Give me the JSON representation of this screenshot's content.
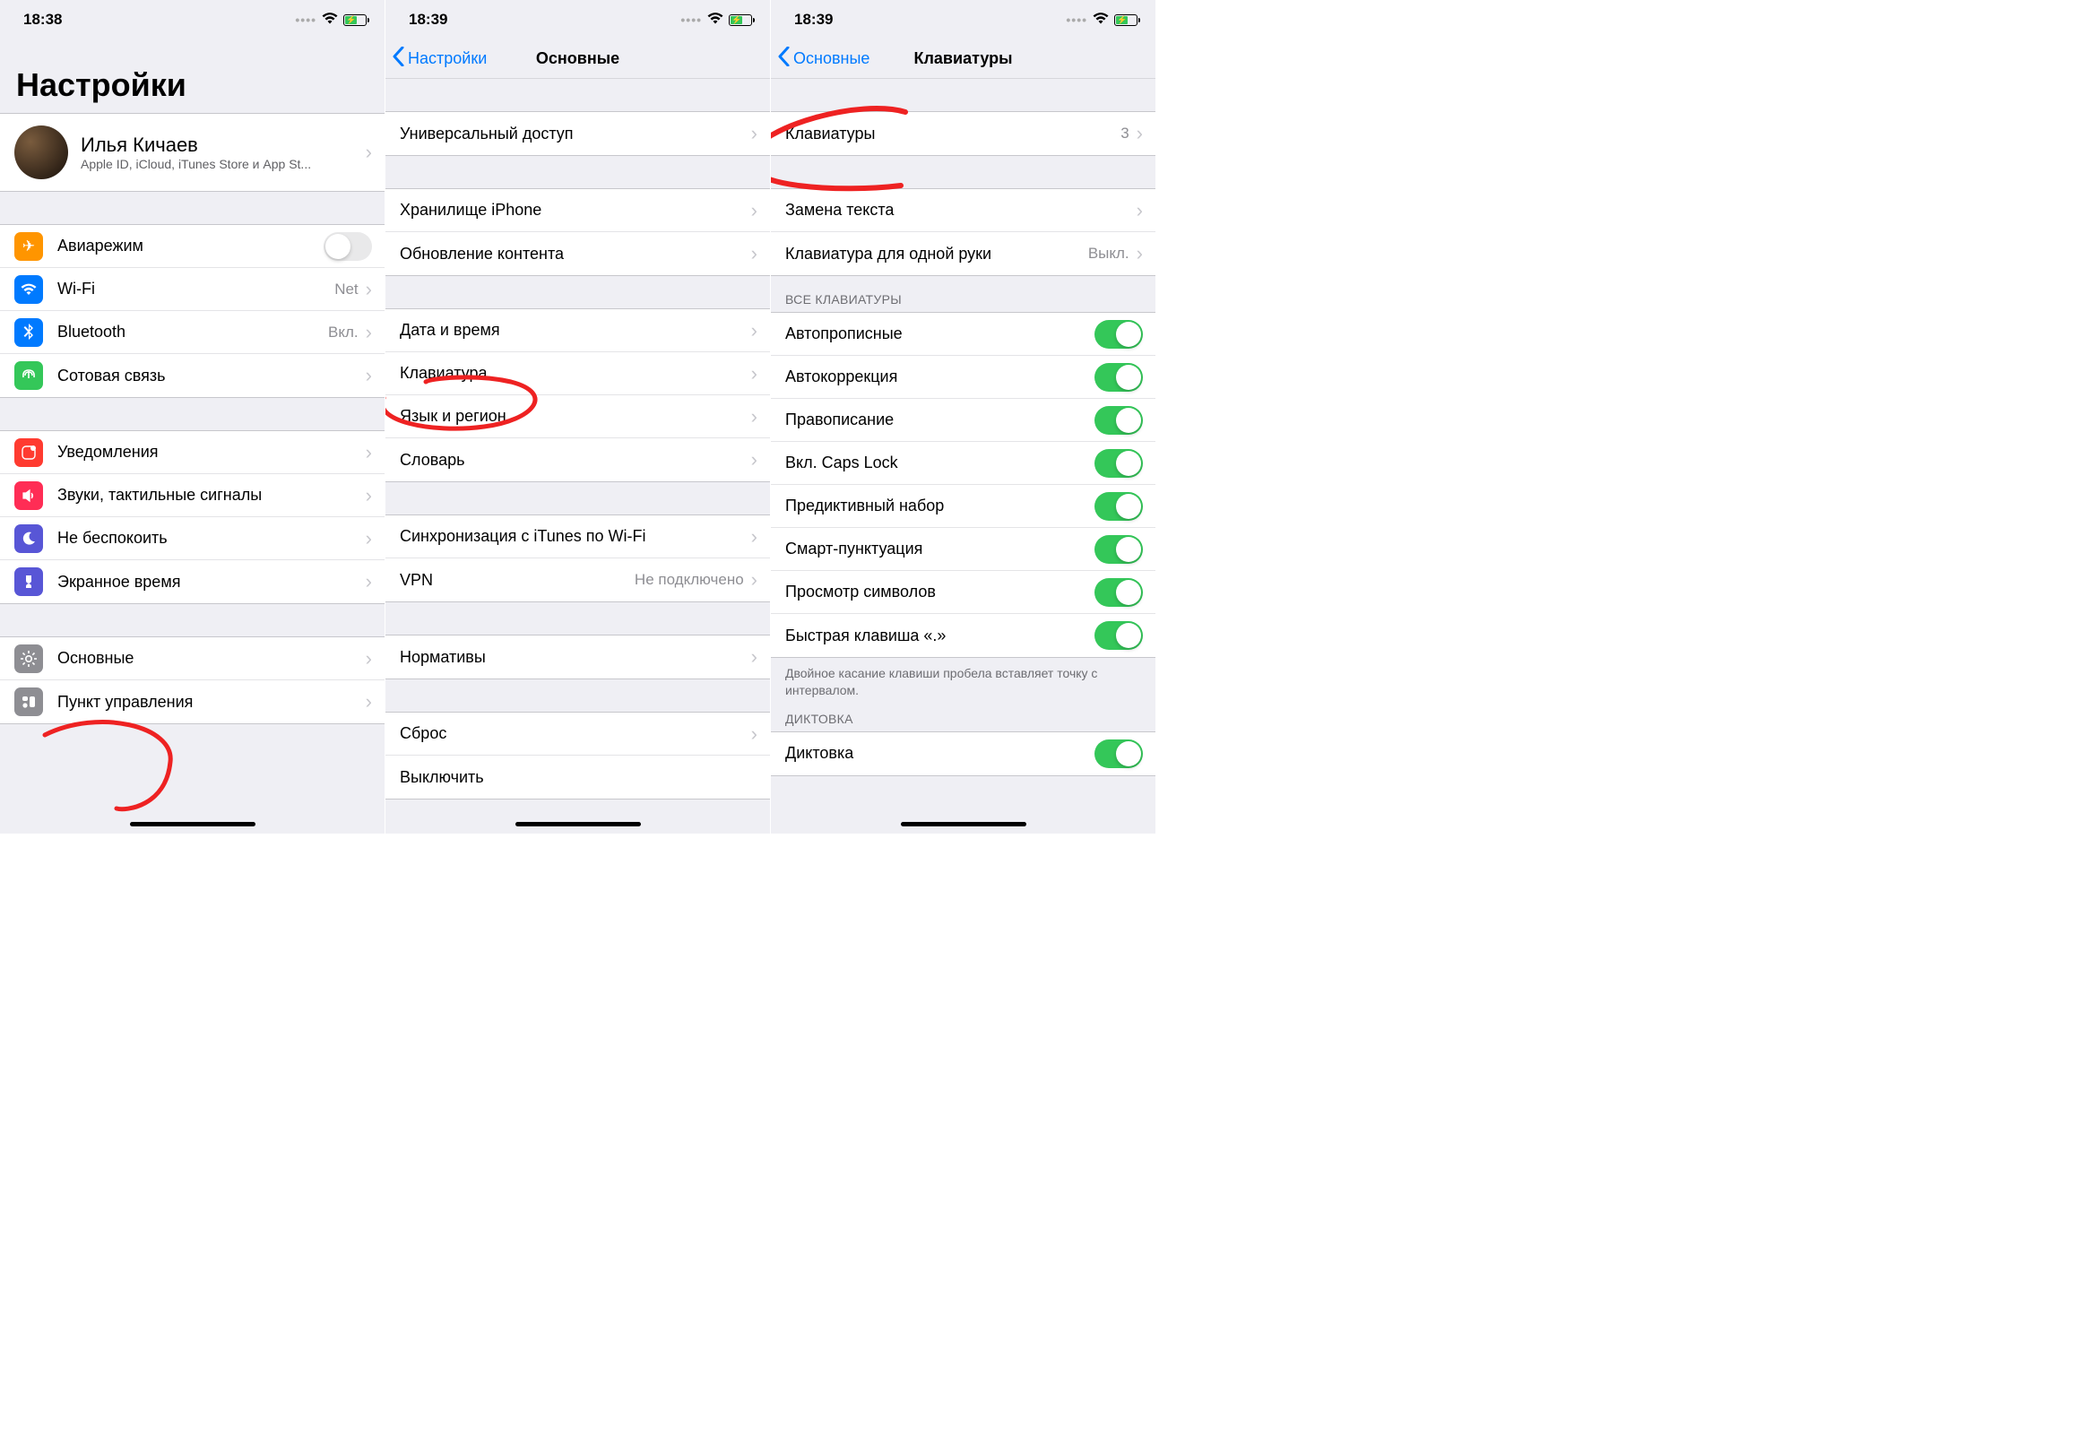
{
  "screens": {
    "settings": {
      "time": "18:38",
      "title": "Настройки",
      "profile": {
        "name": "Илья Кичаев",
        "sub": "Apple ID, iCloud, iTunes Store и App St..."
      },
      "rows": {
        "airplane": "Авиарежим",
        "wifi": "Wi-Fi",
        "wifi_val": "Net",
        "bluetooth": "Bluetooth",
        "bluetooth_val": "Вкл.",
        "cellular": "Сотовая связь",
        "notifications": "Уведомления",
        "sounds": "Звуки, тактильные сигналы",
        "dnd": "Не беспокоить",
        "screentime": "Экранное время",
        "general": "Основные",
        "control": "Пункт управления"
      }
    },
    "general": {
      "time": "18:39",
      "back": "Настройки",
      "title": "Основные",
      "rows": {
        "accessibility": "Универсальный доступ",
        "storage": "Хранилище iPhone",
        "refresh": "Обновление контента",
        "datetime": "Дата и время",
        "keyboard": "Клавиатура",
        "language": "Язык и регион",
        "dictionary": "Словарь",
        "itunes": "Синхронизация с iTunes по Wi-Fi",
        "vpn": "VPN",
        "vpn_val": "Не подключено",
        "regulatory": "Нормативы",
        "reset": "Сброс",
        "shutdown": "Выключить"
      }
    },
    "keyboard": {
      "time": "18:39",
      "back": "Основные",
      "title": "Клавиатуры",
      "rows": {
        "keyboards": "Клавиатуры",
        "keyboards_count": "3",
        "replace": "Замена текста",
        "onehand": "Клавиатура для одной руки",
        "onehand_val": "Выкл.",
        "header_all": "ВСЕ КЛАВИАТУРЫ",
        "autocap": "Автопрописные",
        "autocorrect": "Автокоррекция",
        "spell": "Правописание",
        "caps": "Вкл. Caps Lock",
        "predict": "Предиктивный набор",
        "smart": "Смарт-пунктуация",
        "preview": "Просмотр символов",
        "shortcut": "Быстрая клавиша «.»",
        "footer": "Двойное касание клавиши пробела вставляет точку с интервалом.",
        "header_dict": "ДИКТОВКА",
        "dictation": "Диктовка"
      }
    }
  }
}
